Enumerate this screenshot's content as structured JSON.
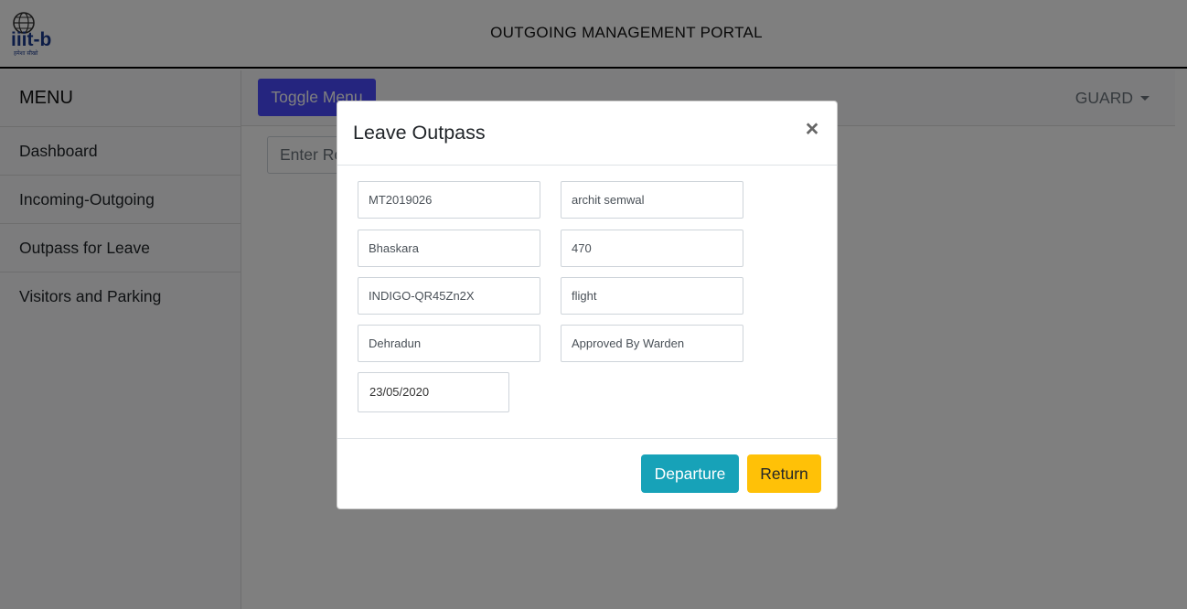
{
  "header": {
    "logo_text": "iiit-b",
    "logo_subtitle": "हमेशा सीखो",
    "portal_title": "OUTGOING MANAGEMENT PORTAL"
  },
  "sidebar": {
    "heading": "MENU",
    "items": [
      {
        "label": "Dashboard"
      },
      {
        "label": "Incoming-Outgoing"
      },
      {
        "label": "Outpass for Leave"
      },
      {
        "label": "Visitors and Parking"
      }
    ]
  },
  "navbar": {
    "toggle_label": "Toggle Menu",
    "user_label": "GUARD"
  },
  "search": {
    "placeholder": "Enter Roll No."
  },
  "modal": {
    "title": "Leave Outpass",
    "close_symbol": "×",
    "fields": {
      "roll_no": "MT2019026",
      "name": "archit semwal",
      "hostel": "Bhaskara",
      "room": "470",
      "travel_ref": "INDIGO-QR45Zn2X",
      "mode": "flight",
      "destination": "Dehradun",
      "status": "Approved By Warden",
      "date": "23/05/2020"
    },
    "departure_label": "Departure",
    "return_label": "Return"
  },
  "colors": {
    "toggle_button": "#4a4aff",
    "departure_button": "#17a2b8",
    "return_button": "#ffc107",
    "logo_blue": "#1b3b8f"
  }
}
